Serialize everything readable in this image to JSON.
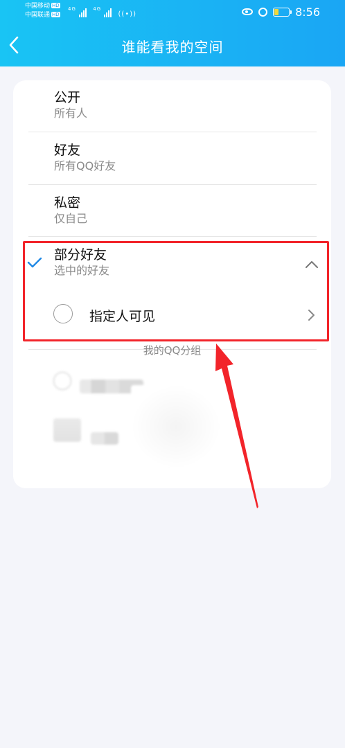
{
  "status_bar": {
    "carrier1": "中国移动",
    "carrier2": "中国联通",
    "hd_badge": "HD",
    "network": "4G",
    "time": "8:56"
  },
  "header": {
    "title": "谁能看我的空间"
  },
  "options": [
    {
      "title": "公开",
      "subtitle": "所有人"
    },
    {
      "title": "好友",
      "subtitle": "所有QQ好友"
    },
    {
      "title": "私密",
      "subtitle": "仅自己"
    },
    {
      "title": "部分好友",
      "subtitle": "选中的好友",
      "selected": true
    }
  ],
  "expanded": {
    "designate_label": "指定人可见",
    "group_label": "我的QQ分组"
  },
  "colors": {
    "header_gradient": [
      "#19c4f4",
      "#1aa6f4"
    ],
    "check": "#1e88e5",
    "annotation": "#f2242a"
  },
  "icons": {
    "back": "chevron-left-icon",
    "check": "check-icon",
    "collapse": "chevron-up-icon",
    "enter": "chevron-right-icon"
  }
}
